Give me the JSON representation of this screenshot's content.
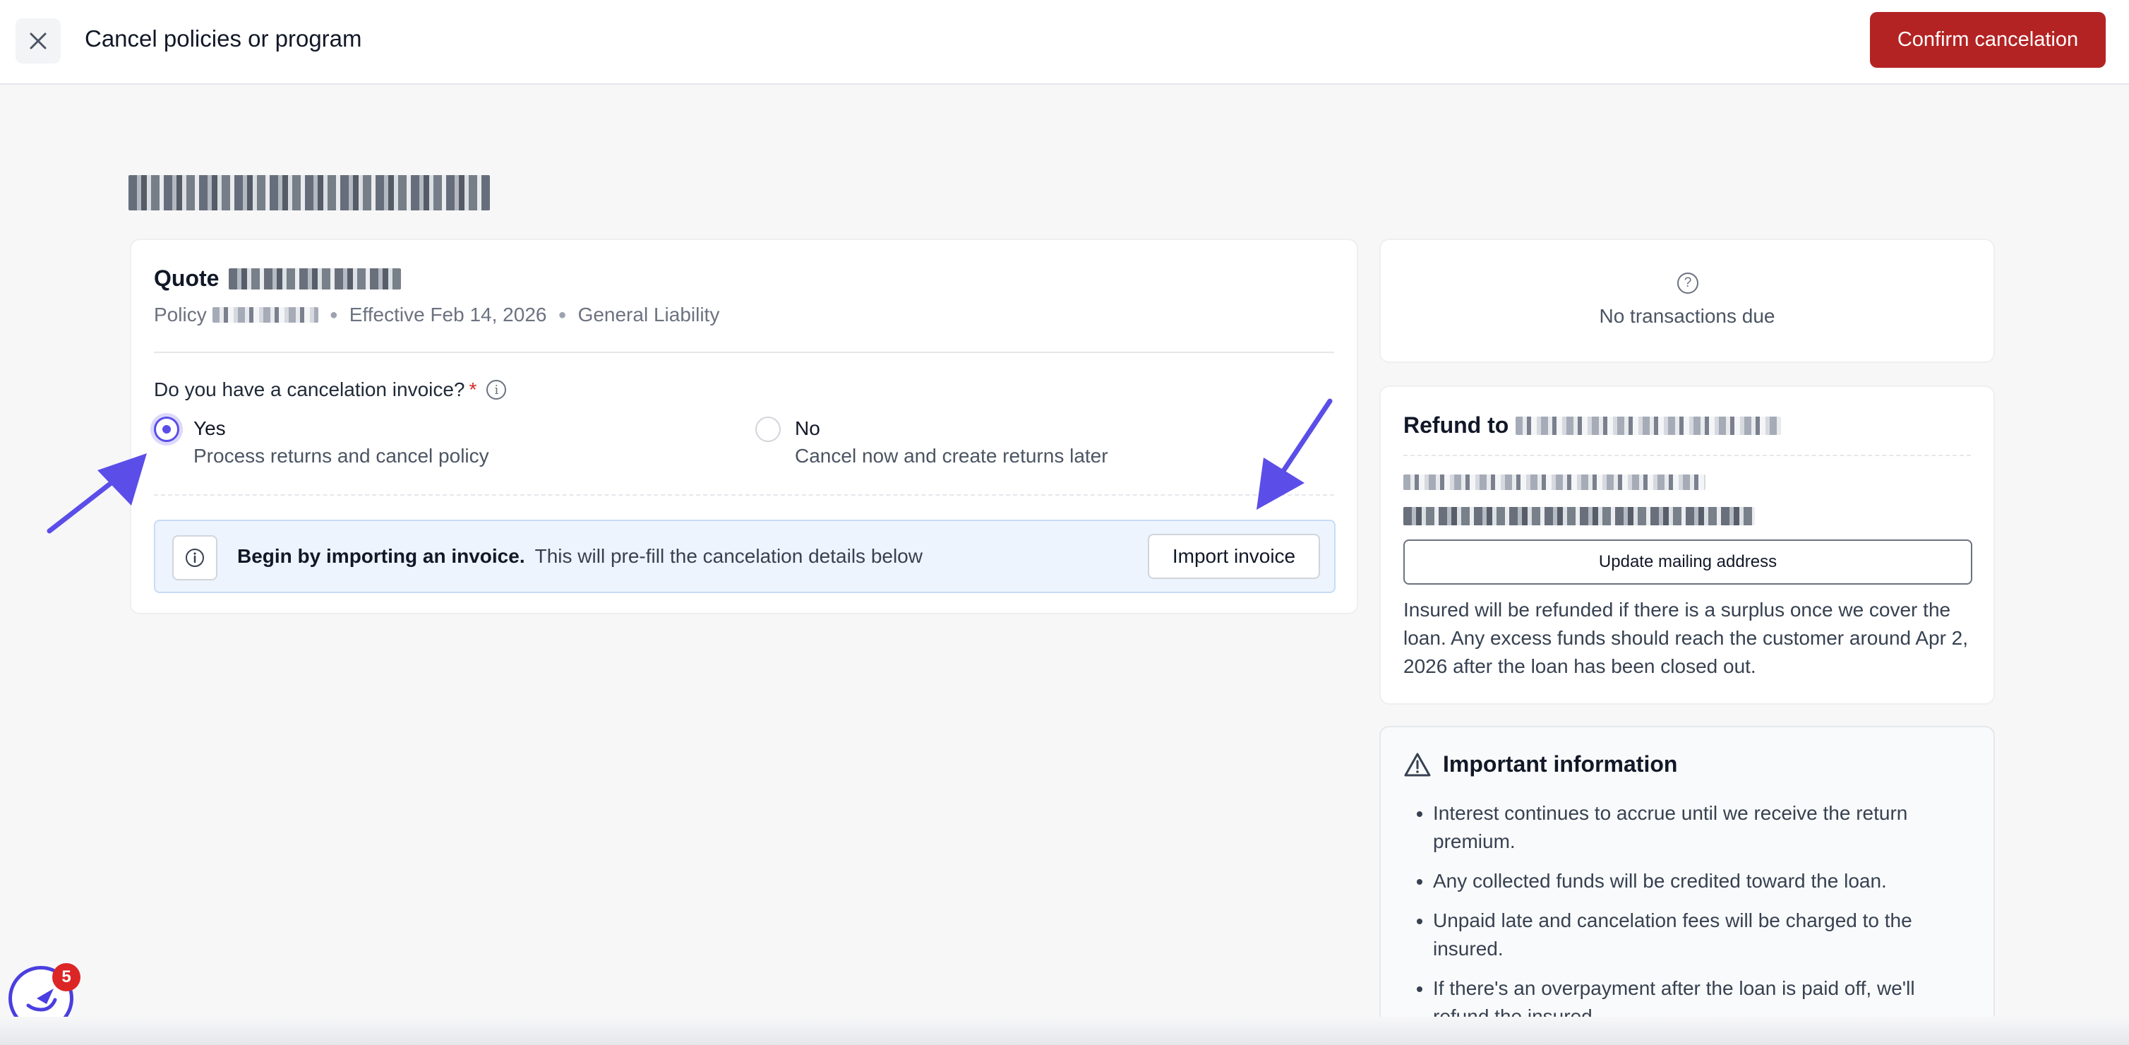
{
  "header": {
    "title": "Cancel policies or program",
    "confirm_label": "Confirm cancelation",
    "close_icon": "close-icon"
  },
  "quote": {
    "label": "Quote",
    "policy_label": "Policy",
    "effective": "Effective Feb 14, 2026",
    "line_of_business": "General Liability"
  },
  "question": {
    "text": "Do you have a cancelation invoice?",
    "required_mark": "*",
    "info_icon": "i",
    "options": [
      {
        "label": "Yes",
        "description": "Process returns and cancel policy",
        "selected": true
      },
      {
        "label": "No",
        "description": "Cancel now and create returns later",
        "selected": false
      }
    ]
  },
  "banner": {
    "icon": "info-icon",
    "bold": "Begin by importing an invoice.",
    "text": "This will pre-fill the cancelation details below",
    "button_label": "Import invoice"
  },
  "transactions": {
    "icon": "?",
    "text": "No transactions due"
  },
  "refund": {
    "title": "Refund to",
    "update_button": "Update mailing address",
    "note": "Insured will be refunded if there is a surplus once we cover the loan. Any excess funds should reach the customer around Apr 2, 2026 after the loan has been closed out."
  },
  "important": {
    "title": "Important information",
    "items": [
      "Interest continues to accrue until we receive the return premium.",
      "Any collected funds will be credited toward the loan.",
      "Unpaid late and cancelation fees will be charged to the insured.",
      "If there's an overpayment after the loan is paid off, we'll refund the insured."
    ]
  },
  "fab": {
    "badge_count": "5"
  },
  "colors": {
    "primary": "#5b4ee8",
    "danger": "#b42323",
    "annotation_arrow": "#5b4ee8"
  }
}
